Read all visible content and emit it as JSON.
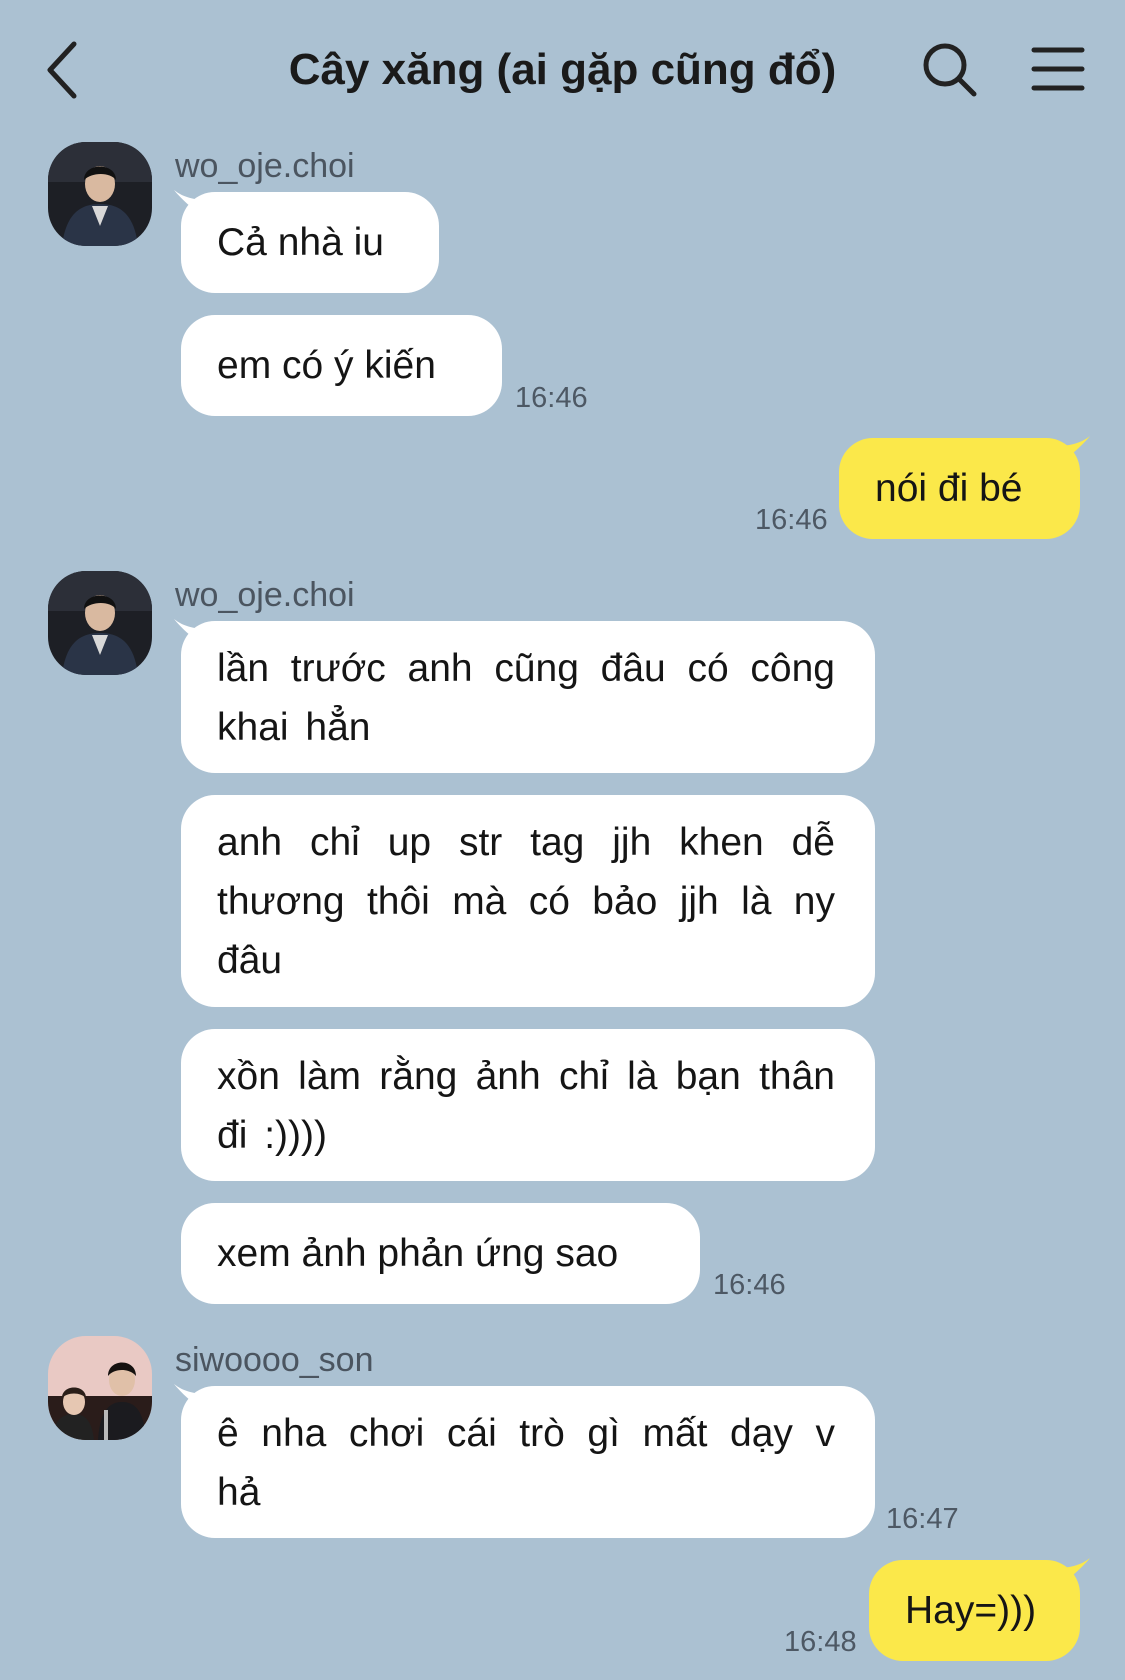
{
  "header": {
    "title": "Cây xăng (ai gặp cũng đổ)",
    "back_icon": "chevron-left-icon",
    "search_icon": "search-icon",
    "menu_icon": "hamburger-menu-icon"
  },
  "colors": {
    "background": "#abc1d2",
    "incoming_bubble": "#ffffff",
    "outgoing_bubble": "#fbe84a"
  },
  "messages": [
    {
      "sender": "wo_oje.choi",
      "text": "Cả nhà iu"
    },
    {
      "text": "em có ý kiến",
      "time": "16:46"
    },
    {
      "outgoing": true,
      "text": "nói đi bé",
      "time": "16:46"
    },
    {
      "sender": "wo_oje.choi",
      "text": "lần trước anh cũng đâu có công khai hẳn"
    },
    {
      "text": "anh chỉ up str tag jjh khen dễ thương thôi mà có bảo jjh là ny đâu"
    },
    {
      "text": "xồn làm rằng ảnh chỉ là bạn thân đi :))))"
    },
    {
      "text": "xem ảnh phản ứng sao",
      "time": "16:46"
    },
    {
      "sender": "siwoooo_son",
      "text": "ê nha chơi cái trò gì mất dạy v hả",
      "time": "16:47"
    },
    {
      "outgoing": true,
      "text": "Hay=)))",
      "time": "16:48"
    }
  ]
}
